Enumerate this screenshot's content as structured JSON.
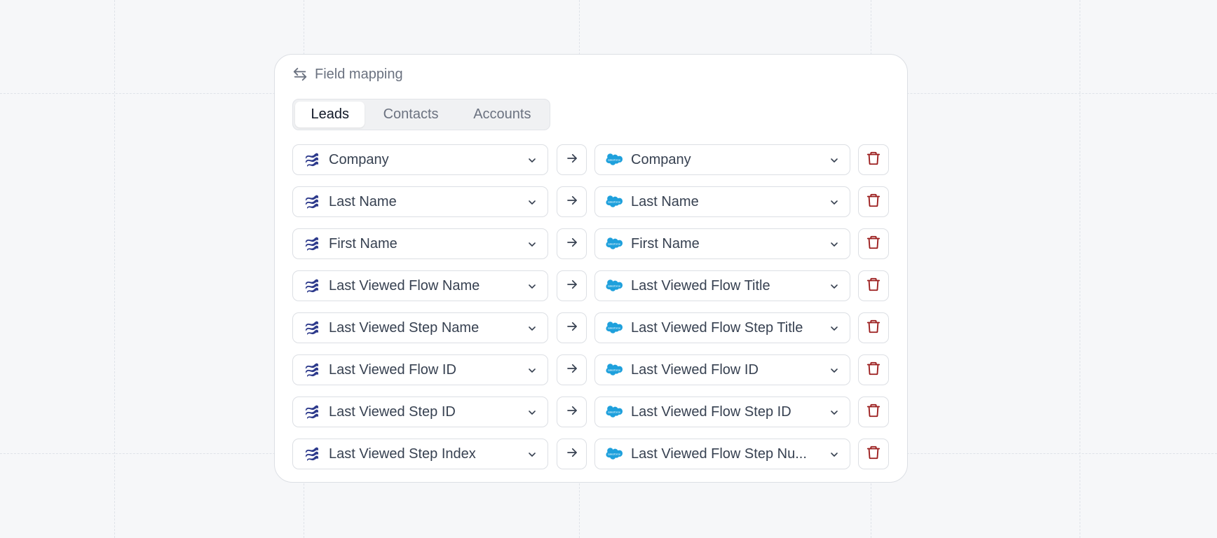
{
  "header": {
    "title": "Field mapping",
    "icon": "swap-arrows-icon"
  },
  "tabs": [
    {
      "label": "Leads",
      "active": true
    },
    {
      "label": "Contacts",
      "active": false
    },
    {
      "label": "Accounts",
      "active": false
    }
  ],
  "colors": {
    "source_icon": "#2d3a8c",
    "target_icon": "#1ea0dc",
    "delete_icon": "#9b1c1c"
  },
  "mappings": [
    {
      "source": "Company",
      "target": "Company"
    },
    {
      "source": "Last Name",
      "target": "Last Name"
    },
    {
      "source": "First Name",
      "target": "First Name"
    },
    {
      "source": "Last Viewed Flow Name",
      "target": "Last Viewed Flow Title"
    },
    {
      "source": "Last Viewed Step Name",
      "target": "Last Viewed Flow Step Title"
    },
    {
      "source": "Last Viewed Flow ID",
      "target": "Last Viewed Flow ID"
    },
    {
      "source": "Last Viewed Step ID",
      "target": "Last Viewed Flow Step ID"
    },
    {
      "source": "Last Viewed Step Index",
      "target": "Last Viewed Flow Step Nu..."
    }
  ]
}
